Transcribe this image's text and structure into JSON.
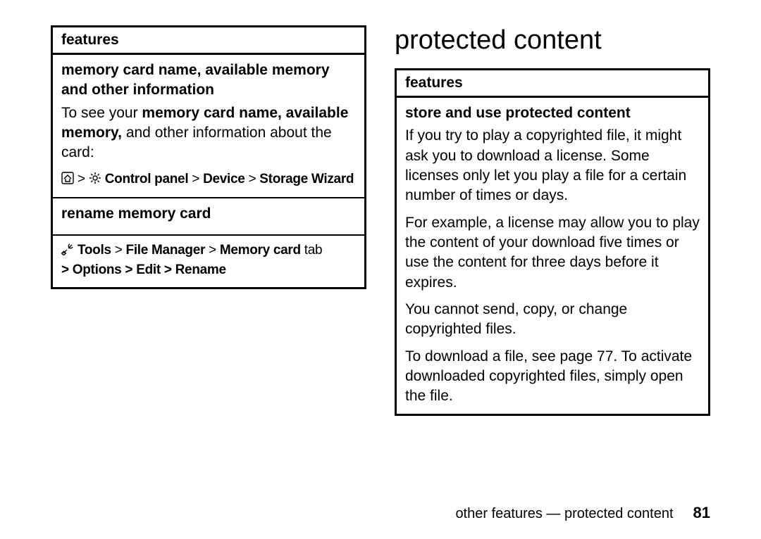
{
  "left": {
    "features_label": "features",
    "row1": {
      "title": "memory card name, available memory and other information",
      "intro_pre": "To see your ",
      "intro_bold": "memory card name, available memory,",
      "intro_post": " and other information about the card:",
      "path_parts": {
        "sep1": " > ",
        "sep2": " > ",
        "sep3": " > ",
        "p1": "Control panel",
        "p2": "Device",
        "p3": "Storage Wizard"
      }
    },
    "row2": {
      "title": "rename memory card",
      "path": {
        "sep1": " > ",
        "p1": "Tools",
        "sep2": " > ",
        "p2": "File Manager",
        "sep3": " >  ",
        "p3": "Memory card",
        "tab": " tab",
        "line2": "> Options > Edit > Rename"
      }
    }
  },
  "right": {
    "heading": "protected content",
    "features_label": "features",
    "row1": {
      "title": "store and use protected content",
      "para1": "If you try to play a copyrighted file, it might ask you to download a license. Some licenses only let you play a file for a certain number of times or days.",
      "para2": "For example, a license may allow you to play the content of your download five times or use the content for three days before it expires.",
      "para3": "You cannot send, copy, or change copyrighted files.",
      "para4": "To download a file, see page 77. To activate downloaded copyrighted files, simply open the file."
    }
  },
  "footer": {
    "text": "other features — protected content",
    "page": "81"
  }
}
